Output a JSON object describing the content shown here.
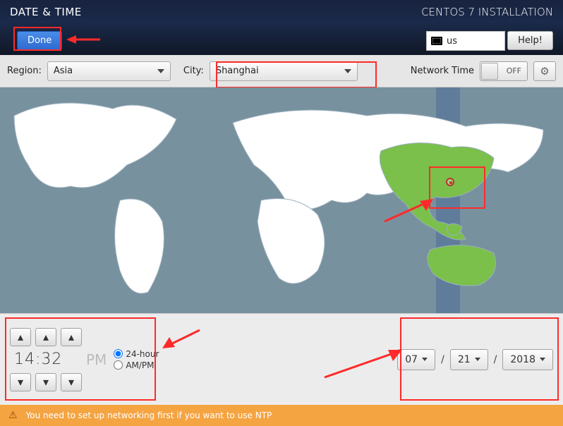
{
  "banner": {
    "title": "DATE & TIME",
    "product": "CENTOS 7 INSTALLATION",
    "done_label": "Done",
    "help_label": "Help!",
    "keyboard_layout": "us"
  },
  "filters": {
    "region_label": "Region:",
    "region_value": "Asia",
    "city_label": "City:",
    "city_value": "Shanghai",
    "network_time_label": "Network Time",
    "network_time_state": "OFF"
  },
  "time": {
    "display": "14:32",
    "meridiem": "PM",
    "format_24h_label": "24-hour",
    "format_ampm_label": "AM/PM",
    "format_selected": "24-hour"
  },
  "date": {
    "month": "07",
    "day": "21",
    "year": "2018",
    "separator": "/"
  },
  "warning": {
    "text": "You need to set up networking first if you want to use NTP"
  },
  "icons": {
    "gear": "⚙",
    "up": "▴",
    "down": "▾",
    "warn": "⚠"
  },
  "map": {
    "selected_region": "China / East Asia",
    "marker_city": "Shanghai"
  }
}
